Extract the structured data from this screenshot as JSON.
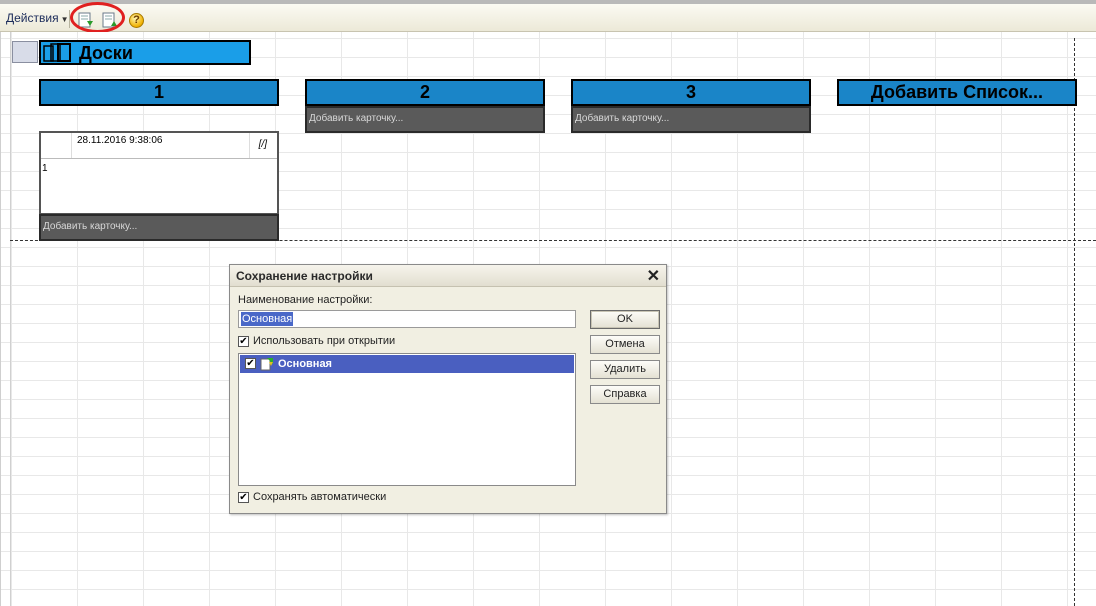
{
  "toolbar": {
    "actions_label": "Действия",
    "help_glyph": "?"
  },
  "board": {
    "title": "Доски",
    "columns": [
      {
        "title": "1"
      },
      {
        "title": "2"
      },
      {
        "title": "3"
      },
      {
        "title": "Добавить Список..."
      }
    ],
    "add_card_label": "Добавить карточку...",
    "card": {
      "date": "28.11.2016 9:38:06",
      "edit_glyph": "[/]",
      "text": "1"
    }
  },
  "dialog": {
    "title": "Сохранение настройки",
    "close_glyph": "✕",
    "name_label": "Наименование настройки:",
    "name_value": "Основная",
    "use_on_open_label": "Использовать при открытии",
    "use_on_open_checked": true,
    "list_items": [
      {
        "label": "Основная",
        "checked": true,
        "selected": true
      }
    ],
    "autosave_label": "Сохранять автоматически",
    "autosave_checked": true,
    "buttons": {
      "ok": "OK",
      "cancel": "Отмена",
      "delete": "Удалить",
      "help": "Справка"
    }
  },
  "colors": {
    "header_blue": "#1a85c8",
    "boards_blue": "#1a9ee8",
    "add_card_gray": "#5a5a5a",
    "selection": "#4a5fc0",
    "highlight_ring": "#e02020"
  }
}
